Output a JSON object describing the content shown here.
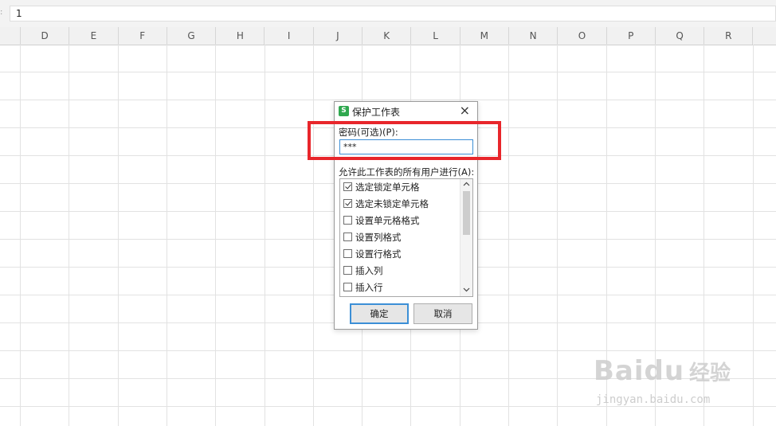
{
  "formula_bar": {
    "value": "1"
  },
  "columns": [
    "D",
    "E",
    "F",
    "G",
    "H",
    "I",
    "J",
    "K",
    "L",
    "M",
    "N",
    "O",
    "P",
    "Q",
    "R"
  ],
  "dialog": {
    "logo_letter": "S",
    "title": "保护工作表",
    "close_glyph": "×",
    "password_label": "密码(可选)(P):",
    "password_value": "***",
    "allow_label": "允许此工作表的所有用户进行(A):",
    "permissions": [
      {
        "label": "选定锁定单元格",
        "checked": true
      },
      {
        "label": "选定未锁定单元格",
        "checked": true
      },
      {
        "label": "设置单元格格式",
        "checked": false
      },
      {
        "label": "设置列格式",
        "checked": false
      },
      {
        "label": "设置行格式",
        "checked": false
      },
      {
        "label": "插入列",
        "checked": false
      },
      {
        "label": "插入行",
        "checked": false
      }
    ],
    "ok_label": "确定",
    "cancel_label": "取消",
    "scroll_up_icon": "chevron-up-icon",
    "scroll_down_icon": "chevron-down-icon"
  },
  "highlight_color": "#e8262b",
  "watermark": {
    "brand": "Baidu",
    "cn": "经验",
    "url": "jingyan.baidu.com"
  }
}
